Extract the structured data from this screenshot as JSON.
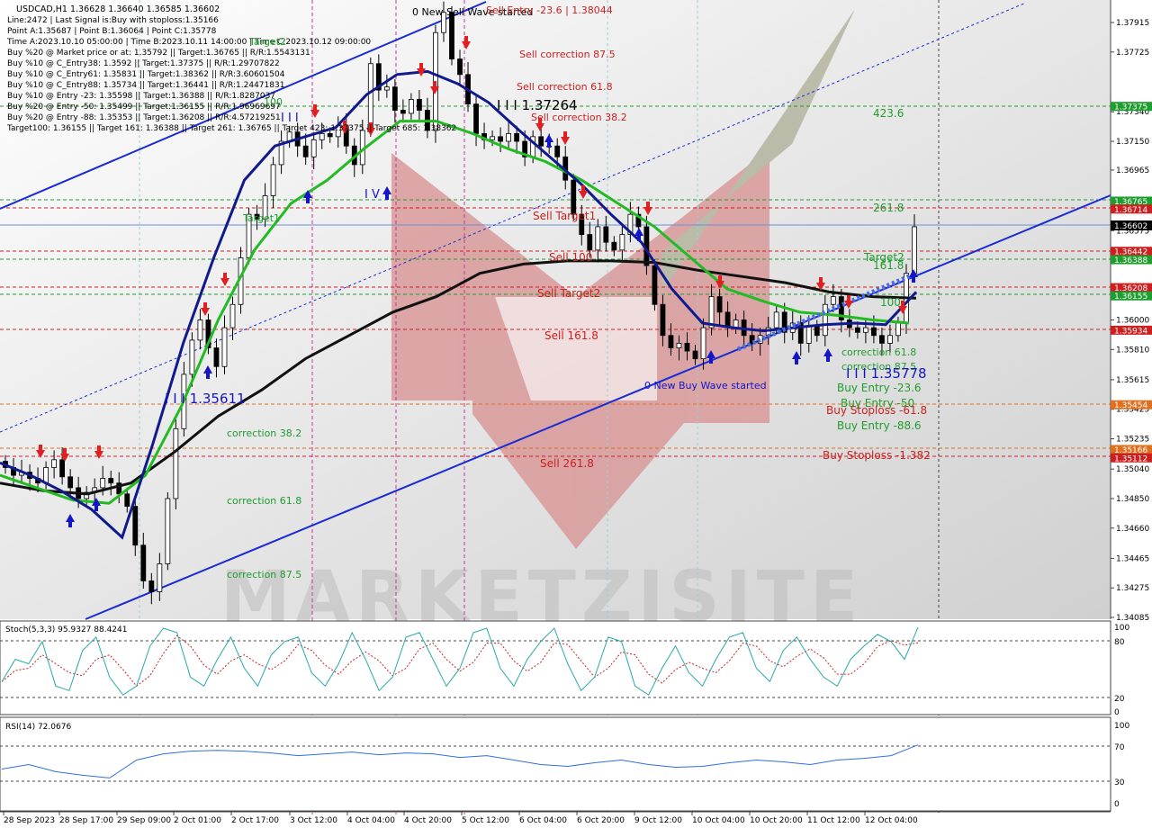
{
  "header": {
    "symbol_line": "USDCAD,H1  1.36628 1.36640 1.36585 1.36602",
    "info_lines": [
      "Line:2472 | Last Signal is:Buy with stoploss:1.35166",
      "Point A:1.35687 | Point B:1.36064 | Point C:1.35778",
      "Time A:2023.10.10 05:00:00 | Time B:2023.10.11 14:00:00 | Time C:2023.10.12 09:00:00",
      "Buy %20 @ Market price or at: 1.35792 || Target:1.36765 || R/R:1.5543131",
      "Buy %10 @ C_Entry38: 1.3592 || Target:1.37375 || R/R:1.29707822",
      "Buy %10 @ C_Entry61: 1.35831 || Target:1.38362 || R/R:3.60601504",
      "Buy %10 @ C_Entry88: 1.35734 || Target:1.36441 || R/R:1.24471831",
      "Buy %10 @ Entry -23: 1.35598 || Target:1.36388 || R/R:1.8287037",
      "Buy %20 @ Entry -50: 1.35499 || Target:1.36155 || R/R:1.96969697",
      "Buy %20 @ Entry -88: 1.35353 || Target:1.36208 || R/R:4.57219251",
      "Target100: 1.36155 || Target 161: 1.36388 || Target 261: 1.36765 || Target 423: 1.37375 || Target 685: 1.38362"
    ]
  },
  "watermark": "MARKETZISITE",
  "price_axis": {
    "ticks": [
      "1.37915",
      "1.37725",
      "1.37340",
      "1.37150",
      "1.36965",
      "1.36575",
      "1.36385",
      "1.36000",
      "1.35810",
      "1.35615",
      "1.35425",
      "1.35235",
      "1.35040",
      "1.34850",
      "1.34660",
      "1.34465",
      "1.34275",
      "1.34085"
    ],
    "current_price": "1.36602"
  },
  "level_tags": [
    {
      "text": "1.37375",
      "color": "#1e9e2e"
    },
    {
      "text": "1.36765",
      "color": "#1e9e2e"
    },
    {
      "text": "1.36714",
      "color": "#cc2020"
    },
    {
      "text": "1.36442",
      "color": "#cc2020"
    },
    {
      "text": "1.36388",
      "color": "#1e9e2e"
    },
    {
      "text": "1.36208",
      "color": "#cc2020"
    },
    {
      "text": "1.36155",
      "color": "#1e9e2e"
    },
    {
      "text": "1.35934",
      "color": "#cc2020"
    },
    {
      "text": "1.35454",
      "color": "#e07020"
    },
    {
      "text": "1.35166",
      "color": "#e07020"
    },
    {
      "text": "1.35112",
      "color": "#cc2020"
    }
  ],
  "annotations": [
    {
      "text": "0 New Sell Wave started",
      "color": "#000000"
    },
    {
      "text": "Sell Entry -23.6 | 1.38044",
      "color": "#cc2020"
    },
    {
      "text": "Sell correction 87.5",
      "color": "#cc2020"
    },
    {
      "text": "Sell correction 61.8",
      "color": "#cc2020"
    },
    {
      "text": "I I I 1.37264",
      "color": "#000000"
    },
    {
      "text": "Sell correction 38.2",
      "color": "#cc2020"
    },
    {
      "text": "Sell Target1",
      "color": "#cc2020"
    },
    {
      "text": "Sell 100",
      "color": "#cc2020"
    },
    {
      "text": "Sell Target2",
      "color": "#cc2020"
    },
    {
      "text": "Sell 161.8",
      "color": "#cc2020"
    },
    {
      "text": "Sell 261.8",
      "color": "#cc2020"
    },
    {
      "text": "423.6",
      "color": "#1e9e2e"
    },
    {
      "text": "261.8",
      "color": "#1e9e2e"
    },
    {
      "text": "Target2",
      "color": "#1e9e2e"
    },
    {
      "text": "161.8",
      "color": "#1e9e2e"
    },
    {
      "text": "100",
      "color": "#1e9e2e"
    },
    {
      "text": "correction 87.5",
      "color": "#1e9e2e"
    },
    {
      "text": "correction 61.8",
      "color": "#1e9e2e"
    },
    {
      "text": "I I I 1.35778",
      "color": "#1515c8"
    },
    {
      "text": "Buy Entry -23.6",
      "color": "#1e9e2e"
    },
    {
      "text": "Buy Entry -50",
      "color": "#1e9e2e"
    },
    {
      "text": "Buy Stoploss -61.8",
      "color": "#cc2020"
    },
    {
      "text": "Buy Entry -88.6",
      "color": "#1e9e2e"
    },
    {
      "text": "Buy Stoploss -1.382",
      "color": "#cc2020"
    },
    {
      "text": "0 New Buy Wave started",
      "color": "#1515c8"
    },
    {
      "text": "I I I 1.35611",
      "color": "#1515c8"
    },
    {
      "text": "correction 38.2",
      "color": "#1e9e2e"
    },
    {
      "text": "correction 61.8",
      "color": "#1e9e2e"
    },
    {
      "text": "correction 87.5",
      "color": "#1e9e2e"
    },
    {
      "text": "Target1",
      "color": "#1e9e2e"
    },
    {
      "text": "Target2",
      "color": "#1e9e2e"
    },
    {
      "text": "100",
      "color": "#1e9e2e"
    },
    {
      "text": "I V",
      "color": "#1515c8"
    },
    {
      "text": "I I I",
      "color": "#1515c8"
    }
  ],
  "stoch": {
    "label": "Stoch(5,3,3) 95.9327 88.4241",
    "levels": [
      "100",
      "80",
      "20",
      "0"
    ]
  },
  "rsi": {
    "label": "RSI(14) 72.0676",
    "levels": [
      "100",
      "70",
      "30",
      "0"
    ]
  },
  "time_axis": [
    "28 Sep 2023",
    "28 Sep 17:00",
    "29 Sep 09:00",
    "2 Oct 01:00",
    "2 Oct 17:00",
    "3 Oct 12:00",
    "4 Oct 04:00",
    "4 Oct 20:00",
    "5 Oct 12:00",
    "6 Oct 04:00",
    "6 Oct 20:00",
    "9 Oct 12:00",
    "10 Oct 04:00",
    "10 Oct 20:00",
    "11 Oct 12:00",
    "12 Oct 04:00"
  ],
  "colors": {
    "sell_arrow": "#e02020",
    "buy_arrow": "#1515c8",
    "ma_fast": "#111a8c",
    "ma_mid": "#22bb22",
    "ma_slow": "#111111",
    "channel": "#1a2bd6",
    "stoch_main": "#2aa8a8",
    "stoch_signal": "#cc2020",
    "rsi_line": "#2f6fe0"
  },
  "chart_data": {
    "type": "candlestick",
    "symbol": "USDCAD",
    "timeframe": "H1",
    "ylim": [
      1.34085,
      1.38044
    ],
    "close": [
      1.3505,
      1.35,
      1.3502,
      1.3498,
      1.3495,
      1.3505,
      1.351,
      1.3499,
      1.3492,
      1.3485,
      1.3489,
      1.3492,
      1.3498,
      1.3495,
      1.3488,
      1.348,
      1.3455,
      1.3432,
      1.3425,
      1.3443,
      1.3485,
      1.353,
      1.3565,
      1.3587,
      1.36,
      1.3582,
      1.357,
      1.3595,
      1.361,
      1.364,
      1.3668,
      1.3665,
      1.368,
      1.37,
      1.3715,
      1.3721,
      1.3712,
      1.3705,
      1.3716,
      1.372,
      1.3718,
      1.3725,
      1.3712,
      1.37,
      1.3722,
      1.3765,
      1.3748,
      1.375,
      1.3735,
      1.3733,
      1.3742,
      1.3735,
      1.3722,
      1.3785,
      1.3798,
      1.3768,
      1.3758,
      1.3739,
      1.372,
      1.3716,
      1.3718,
      1.3715,
      1.372,
      1.3715,
      1.3705,
      1.3718,
      1.3712,
      1.3712,
      1.3705,
      1.369,
      1.3668,
      1.3655,
      1.3645,
      1.366,
      1.365,
      1.3645,
      1.3655,
      1.3668,
      1.366,
      1.3635,
      1.361,
      1.359,
      1.3582,
      1.3585,
      1.358,
      1.3575,
      1.3595,
      1.3615,
      1.3605,
      1.3595,
      1.36,
      1.359,
      1.3585,
      1.359,
      1.3595,
      1.3605,
      1.3592,
      1.3598,
      1.3585,
      1.3596,
      1.359,
      1.361,
      1.3615,
      1.36,
      1.3595,
      1.3592,
      1.3595,
      1.359,
      1.3585,
      1.359,
      1.3598,
      1.363,
      1.366
    ],
    "indicators": {
      "ma_fast": [
        1.3508,
        1.35,
        1.349,
        1.3478,
        1.346,
        1.352,
        1.3585,
        1.364,
        1.369,
        1.3712,
        1.3718,
        1.3724,
        1.3745,
        1.3758,
        1.376,
        1.3752,
        1.374,
        1.3722,
        1.3705,
        1.3688,
        1.3668,
        1.365,
        1.362,
        1.3598,
        1.3595,
        1.3593,
        1.3595,
        1.3597,
        1.3598,
        1.3597,
        1.3618
      ],
      "ma_mid": [
        1.35,
        1.3492,
        1.3484,
        1.3482,
        1.35,
        1.3545,
        1.36,
        1.3645,
        1.3675,
        1.369,
        1.371,
        1.3728,
        1.3728,
        1.372,
        1.371,
        1.3702,
        1.369,
        1.3675,
        1.366,
        1.364,
        1.362,
        1.3612,
        1.3605,
        1.3603,
        1.36,
        1.3598
      ],
      "ma_slow": [
        1.3495,
        1.349,
        1.3488,
        1.3495,
        1.3515,
        1.3538,
        1.3555,
        1.3575,
        1.359,
        1.3605,
        1.3615,
        1.363,
        1.3636,
        1.3638,
        1.3638,
        1.3637,
        1.3632,
        1.3628,
        1.3624,
        1.3618,
        1.3615,
        1.3614
      ]
    },
    "stoch_k": [
      35,
      60,
      55,
      80,
      30,
      25,
      70,
      85,
      40,
      20,
      30,
      75,
      95,
      90,
      40,
      30,
      60,
      85,
      50,
      30,
      65,
      80,
      85,
      45,
      30,
      55,
      90,
      60,
      25,
      40,
      85,
      90,
      60,
      30,
      50,
      90,
      95,
      50,
      30,
      60,
      80,
      95,
      55,
      25,
      40,
      85,
      80,
      30,
      20,
      50,
      75,
      45,
      30,
      60,
      85,
      90,
      50,
      35,
      70,
      85,
      60,
      40,
      30,
      60,
      75,
      88,
      80,
      60,
      96
    ],
    "rsi": [
      45,
      50,
      42,
      38,
      35,
      55,
      62,
      65,
      66,
      65,
      63,
      60,
      62,
      64,
      61,
      63,
      62,
      58,
      60,
      55,
      50,
      48,
      52,
      55,
      50,
      47,
      48,
      52,
      55,
      53,
      50,
      55,
      57,
      60,
      72
    ]
  }
}
